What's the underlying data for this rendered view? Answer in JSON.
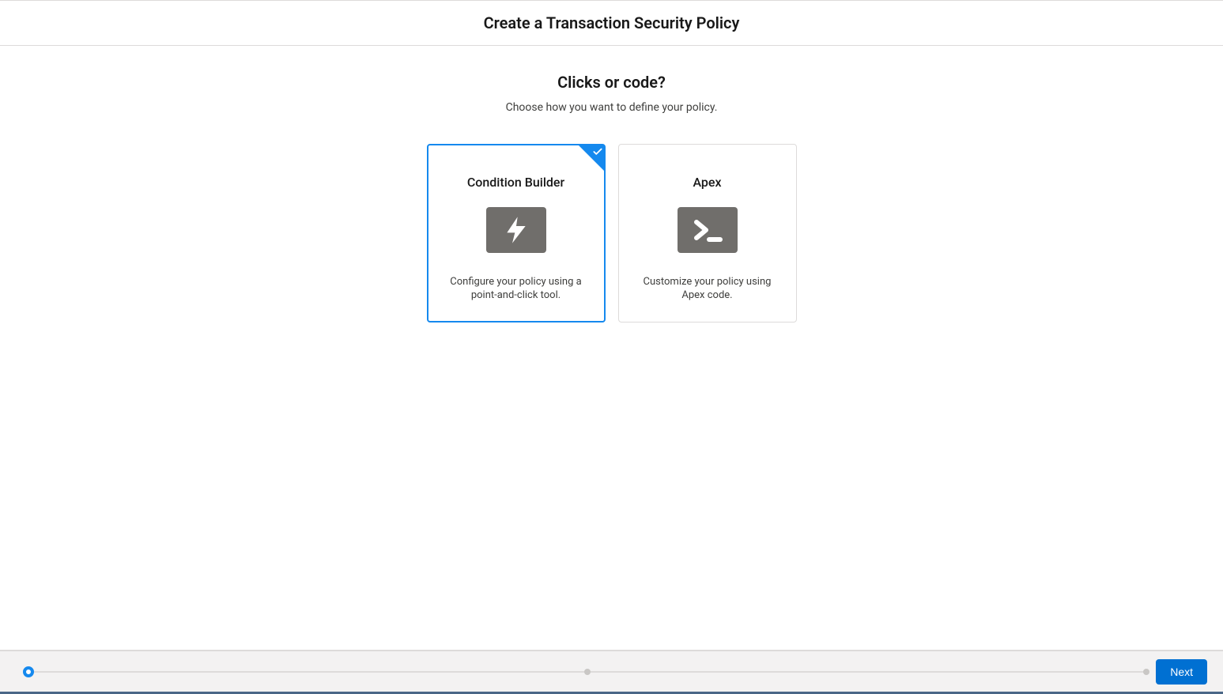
{
  "header": {
    "title": "Create a Transaction Security Policy"
  },
  "section": {
    "title": "Clicks or code?",
    "subtitle": "Choose how you want to define your policy."
  },
  "options": [
    {
      "title": "Condition Builder",
      "description": "Configure your policy using a point-and-click tool.",
      "selected": true,
      "icon": "lightning-bolt-icon"
    },
    {
      "title": "Apex",
      "description": "Customize your policy using Apex code.",
      "selected": false,
      "icon": "terminal-icon"
    }
  ],
  "footer": {
    "next_label": "Next",
    "progress": {
      "steps": 3,
      "current_index": 0
    }
  }
}
